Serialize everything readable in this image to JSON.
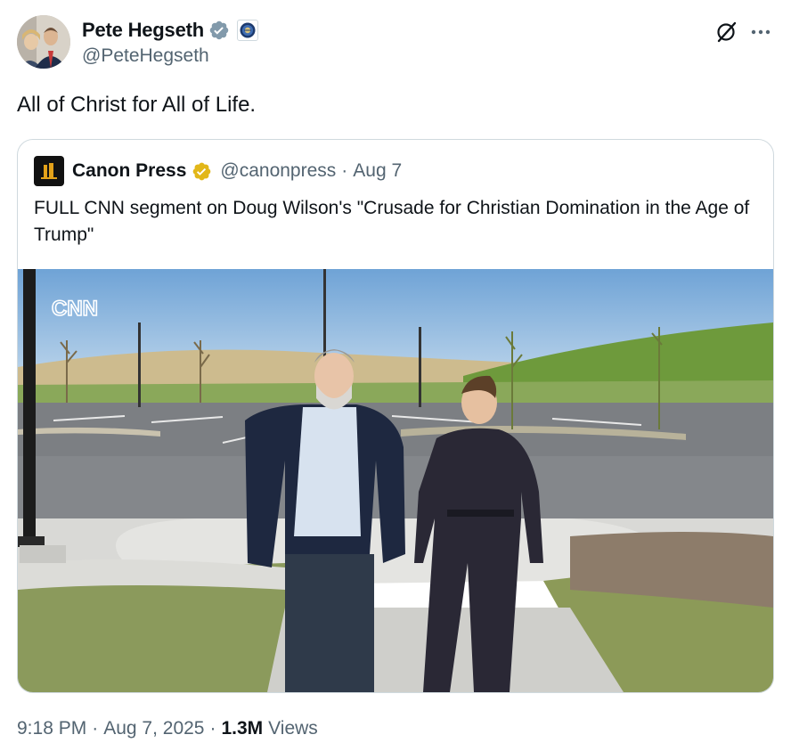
{
  "author": {
    "display_name": "Pete Hegseth",
    "handle": "@PeteHegseth",
    "verified_icon": "verified-badge-icon",
    "affiliation_icon": "dod-seal-icon"
  },
  "tweet": {
    "text": "All of Christ for All of Life."
  },
  "quoted": {
    "display_name": "Canon Press",
    "handle": "@canonpress",
    "sep": "·",
    "date": "Aug 7",
    "text": "FULL CNN segment on Doug Wilson's \"Crusade for Christian Domination in the Age of Trump\"",
    "media_watermark": "CNN"
  },
  "footer": {
    "time": "9:18 PM",
    "sep1": "·",
    "date": "Aug 7, 2025",
    "sep2": "·",
    "views_count": "1.3M",
    "views_label": "Views"
  },
  "colors": {
    "text_primary": "#0f1419",
    "text_secondary": "#536471",
    "verified_blue": "#829aab",
    "verified_gold": "#e2b719",
    "border": "#cfd9de"
  }
}
